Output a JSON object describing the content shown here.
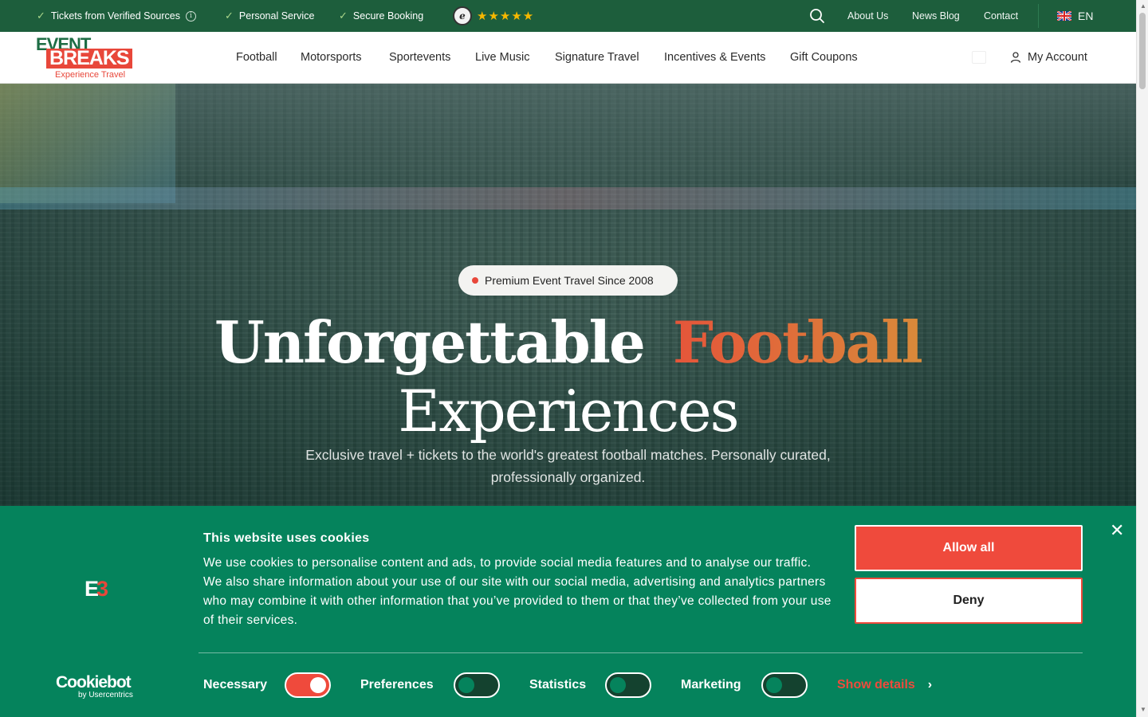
{
  "topbar": {
    "usps": [
      "Tickets from Verified Sources",
      "Personal Service",
      "Secure Booking"
    ],
    "rating_stars": "★★★★★",
    "links": [
      "About Us",
      "News Blog",
      "Contact"
    ],
    "language": "EN"
  },
  "nav": {
    "logo": {
      "line1": "EVENT",
      "line2": "BREAKS",
      "line3": "Experience Travel"
    },
    "menu": [
      "Football",
      "Motorsports",
      "Sportevents",
      "Live Music",
      "Signature Travel",
      "Incentives & Events",
      "Gift Coupons"
    ],
    "account": "My Account"
  },
  "hero": {
    "badge": "Premium Event Travel Since 2008",
    "title_part1": "Unforgettable",
    "title_accent": "Football",
    "title_part2": "Experiences",
    "subtitle": "Exclusive travel + tickets to the world's greatest football matches. Personally curated, professionally organized."
  },
  "cookie": {
    "logo_mark": "E3",
    "title": "This website uses cookies",
    "text": "We use cookies to personalise content and ads, to provide social media features and to analyse our traffic. We also share information about your use of our site with our social media, advertising and analytics partners who may combine it with other information that you’ve provided to them or that they’ve collected from your use of their services.",
    "allow_label": "Allow all",
    "deny_label": "Deny",
    "brand": "Cookiebot",
    "brand_sub": "by Usercentrics",
    "toggles": [
      {
        "label": "Necessary",
        "on": true
      },
      {
        "label": "Preferences",
        "on": false
      },
      {
        "label": "Statistics",
        "on": false
      },
      {
        "label": "Marketing",
        "on": false
      }
    ],
    "show_details": "Show details",
    "close_symbol": "✕"
  },
  "colors": {
    "topbar": "#1d5e3c",
    "brand_red": "#e8473a",
    "cookie_bg": "#05835c"
  }
}
